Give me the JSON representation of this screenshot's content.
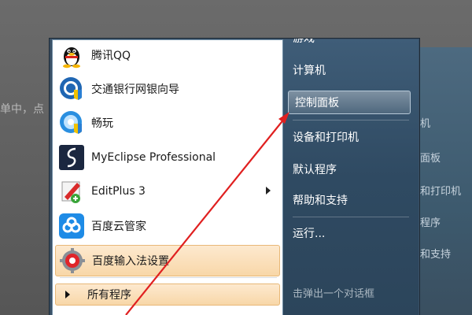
{
  "background": {
    "left_text": "单中，点",
    "right_items": [
      "机",
      "面板",
      "和打印机",
      "程序",
      "和支持"
    ],
    "bottom_text": "击弹出一个对话框"
  },
  "programs": [
    {
      "label": "腾讯QQ",
      "icon": "qq-penguin-icon"
    },
    {
      "label": "交通银行网银向导",
      "icon": "bank-shield-icon"
    },
    {
      "label": "畅玩",
      "icon": "game-disc-icon"
    },
    {
      "label": "MyEclipse Professional",
      "icon": "myeclipse-icon"
    },
    {
      "label": "EditPlus 3",
      "icon": "editplus-icon",
      "has_submenu": true
    },
    {
      "label": "百度云管家",
      "icon": "baidu-cloud-icon"
    },
    {
      "label": "百度输入法设置",
      "icon": "settings-gear-icon",
      "highlighted": true
    }
  ],
  "all_programs_label": "所有程序",
  "right_menu": [
    {
      "label": "游戏"
    },
    {
      "label": "计算机"
    },
    {
      "label": "控制面板",
      "selected": true
    },
    {
      "label": "设备和打印机"
    },
    {
      "label": "默认程序"
    },
    {
      "label": "帮助和支持"
    },
    {
      "label": "运行..."
    }
  ],
  "colors": {
    "highlight": "#f8d7a8",
    "right_pane": "#2f4a62",
    "annotation_arrow": "#e02020"
  }
}
